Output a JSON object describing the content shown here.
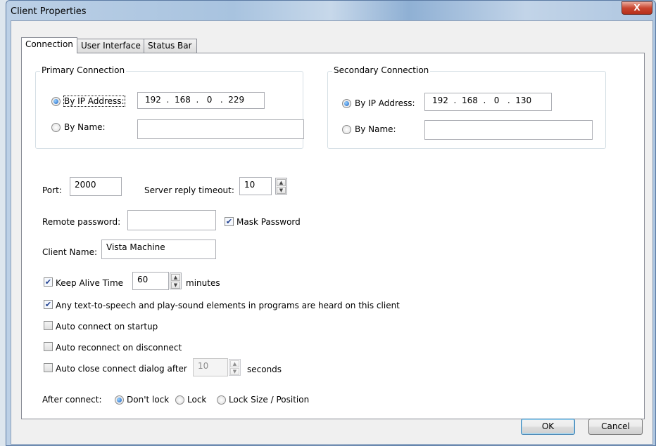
{
  "window": {
    "title": "Client Properties",
    "close_glyph": "X"
  },
  "tabs": [
    {
      "label": "Connection"
    },
    {
      "label": "User Interface"
    },
    {
      "label": "Status Bar"
    }
  ],
  "primary": {
    "group_label": "Primary Connection",
    "by_ip_label": "By IP Address:",
    "ip": "192  .  168  .   0   .  229",
    "by_name_label": "By Name:",
    "name_value": ""
  },
  "secondary": {
    "group_label": "Secondary Connection",
    "by_ip_label": "By IP Address:",
    "ip": "192  .  168  .   0   .  130",
    "by_name_label": "By Name:",
    "name_value": ""
  },
  "port": {
    "label": "Port:",
    "value": "2000"
  },
  "timeout": {
    "label": "Server reply timeout:",
    "value": "10"
  },
  "password": {
    "label": "Remote password:",
    "value": "",
    "mask_label": "Mask Password",
    "mask_checked": true
  },
  "client_name": {
    "label": "Client Name:",
    "value": "Vista Machine"
  },
  "keep_alive": {
    "label": "Keep Alive Time",
    "value": "60",
    "unit": "minutes",
    "checked": true
  },
  "tts": {
    "label": "Any text-to-speech and play-sound elements in programs are heard on this client",
    "checked": true
  },
  "auto_connect": {
    "label": "Auto connect on startup",
    "checked": false
  },
  "auto_reconnect": {
    "label": "Auto reconnect on disconnect",
    "checked": false
  },
  "auto_close": {
    "label": "Auto close connect dialog after",
    "value": "10",
    "unit": "seconds",
    "checked": false
  },
  "after_connect": {
    "label": "After connect:",
    "options": [
      "Don't lock",
      "Lock",
      "Lock Size / Position"
    ],
    "selected": "Don't lock"
  },
  "buttons": {
    "ok": "OK",
    "cancel": "Cancel"
  }
}
